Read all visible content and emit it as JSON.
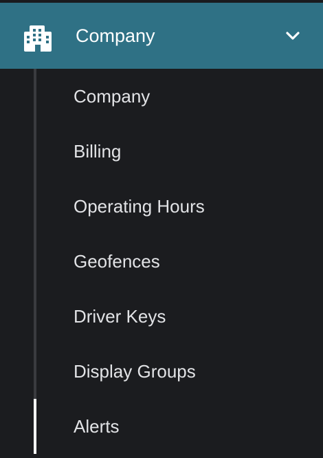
{
  "section": {
    "title": "Company",
    "icon": "building-icon",
    "expanded": true,
    "header_color": "#2f7185"
  },
  "menu": {
    "items": [
      {
        "label": "Company"
      },
      {
        "label": "Billing"
      },
      {
        "label": "Operating Hours"
      },
      {
        "label": "Geofences"
      },
      {
        "label": "Driver Keys"
      },
      {
        "label": "Display Groups"
      },
      {
        "label": "Alerts",
        "active": true
      }
    ]
  }
}
